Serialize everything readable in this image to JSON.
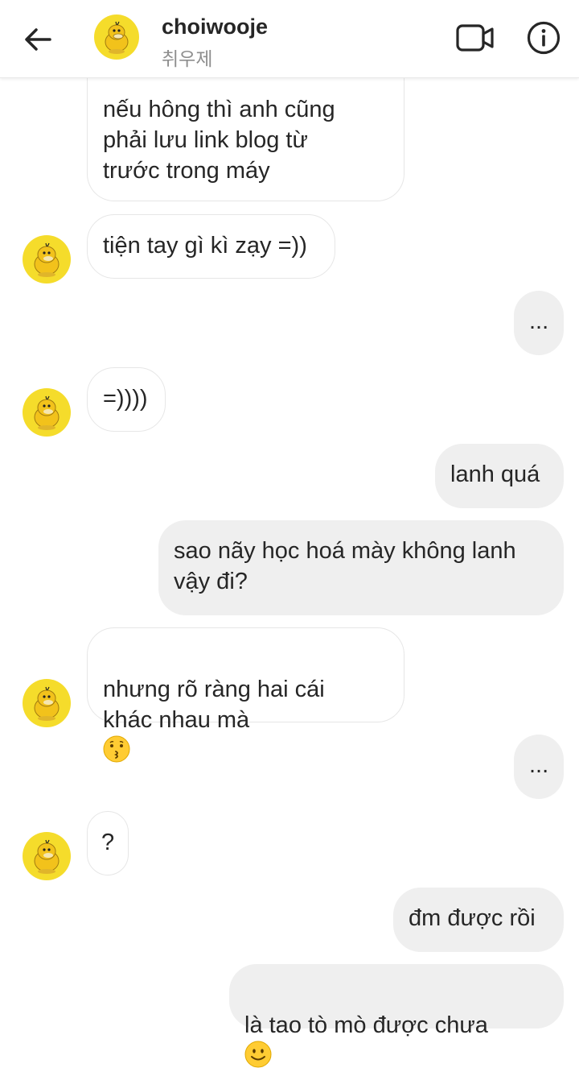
{
  "header": {
    "username": "choiwooje",
    "subname": "취우제"
  },
  "messages": [
    {
      "from": "them",
      "text": "nếu hông thì anh cũng\nphải lưu link blog từ\ntrước trong máy"
    },
    {
      "from": "them",
      "text": "tiện tay gì kì zạy =))"
    },
    {
      "from": "me",
      "text": "..."
    },
    {
      "from": "them",
      "text": "=))))"
    },
    {
      "from": "me",
      "text": "lanh quá"
    },
    {
      "from": "me",
      "text": "sao nãy học hoá mày không lanh\nvậy đi?"
    },
    {
      "from": "them",
      "text": "nhưng rõ ràng hai cái\nkhác nhau mà",
      "emoji": "kissing-face"
    },
    {
      "from": "me",
      "text": "..."
    },
    {
      "from": "them",
      "text": "?"
    },
    {
      "from": "me",
      "text": "đm được rồi"
    },
    {
      "from": "me",
      "text": "là tao tò mò được chưa",
      "emoji": "slightly-smiling-face"
    }
  ],
  "icons": {
    "back": "arrow-left-icon",
    "video": "video-camera-icon",
    "info": "info-icon"
  }
}
